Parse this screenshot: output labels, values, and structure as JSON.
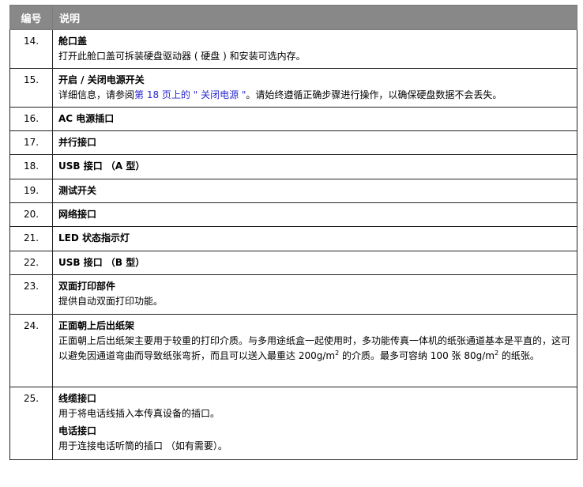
{
  "header": {
    "col_number": "编号",
    "col_desc": "说明"
  },
  "rows": [
    {
      "num": "14.",
      "title": "舱口盖",
      "desc": "打开此舱口盖可拆装硬盘驱动器 ( 硬盘 ) 和安装可选内存。"
    },
    {
      "num": "15.",
      "title": "开启 / 关闭电源开关",
      "desc_pre": "详细信息，请参阅",
      "desc_link": "第  18 页上的 \" 关闭电源 \"",
      "desc_post": "。请始终遵循正确步骤进行操作，以确保硬盘数据不会丢失。"
    },
    {
      "num": "16.",
      "title": "AC 电源插口"
    },
    {
      "num": "17.",
      "title": "并行接口"
    },
    {
      "num": "18.",
      "title": "USB 接口 （A 型）"
    },
    {
      "num": "19.",
      "title": "测试开关"
    },
    {
      "num": "20.",
      "title": "网络接口"
    },
    {
      "num": "21.",
      "title": "LED 状态指示灯"
    },
    {
      "num": "22.",
      "title": "USB 接口 （B 型）"
    },
    {
      "num": "23.",
      "title": "双面打印部件",
      "desc": "提供自动双面打印功能。"
    },
    {
      "num": "24.",
      "title": "正面朝上后出纸架",
      "desc_a": "正面朝上后出纸架主要用于较重的打印介质。与多用途纸盒一起使用时，多功能传真一体机的纸张通道基本是平直的，这可以避免因通道弯曲而导致纸张弯折，而且可以送入最重达 200g/m",
      "sup": "2",
      "desc_b": " 的介质。最多可容纳 100 张 80g/m",
      "desc_c": " 的纸张。"
    },
    {
      "num": "25.",
      "title": "线缆接口",
      "desc": "用于将电话线插入本传真设备的插口。",
      "title2": "电话接口",
      "desc2": "用于连接电话听筒的插口 （如有需要）。"
    }
  ]
}
